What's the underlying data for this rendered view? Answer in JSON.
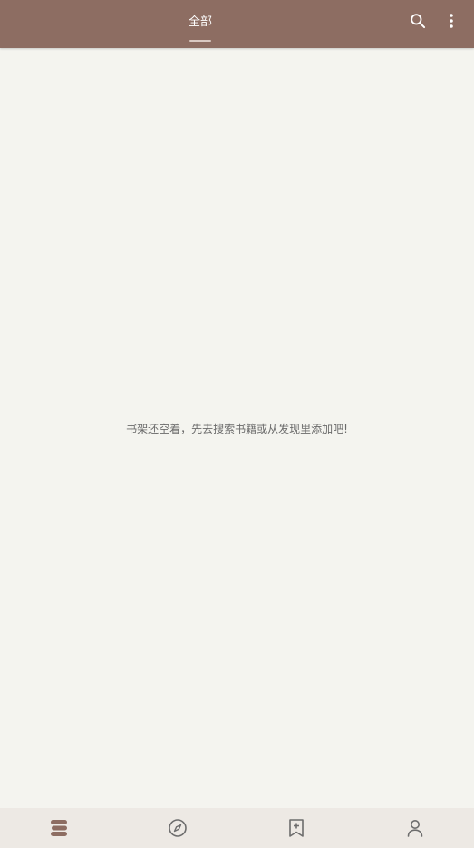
{
  "app_bar": {
    "tabs": [
      {
        "label": "全部",
        "selected": true
      }
    ],
    "actions": {
      "search_icon": "search-icon",
      "more_icon": "more-vert-icon"
    }
  },
  "shelf": {
    "empty_message": "书架还空着，先去搜索书籍或从发现里添加吧!"
  },
  "bottom_nav": {
    "items": [
      {
        "icon": "bookshelf-icon",
        "selected": true
      },
      {
        "icon": "compass-icon",
        "selected": false
      },
      {
        "icon": "bookmark-add-icon",
        "selected": false
      },
      {
        "icon": "person-icon",
        "selected": false
      }
    ]
  },
  "colors": {
    "primary": "#8d6d62",
    "background": "#f4f4ef",
    "bottom_nav_bg": "#ede9e4",
    "icon_selected": "#8d6d62",
    "icon_default": "#6d6d6d"
  }
}
